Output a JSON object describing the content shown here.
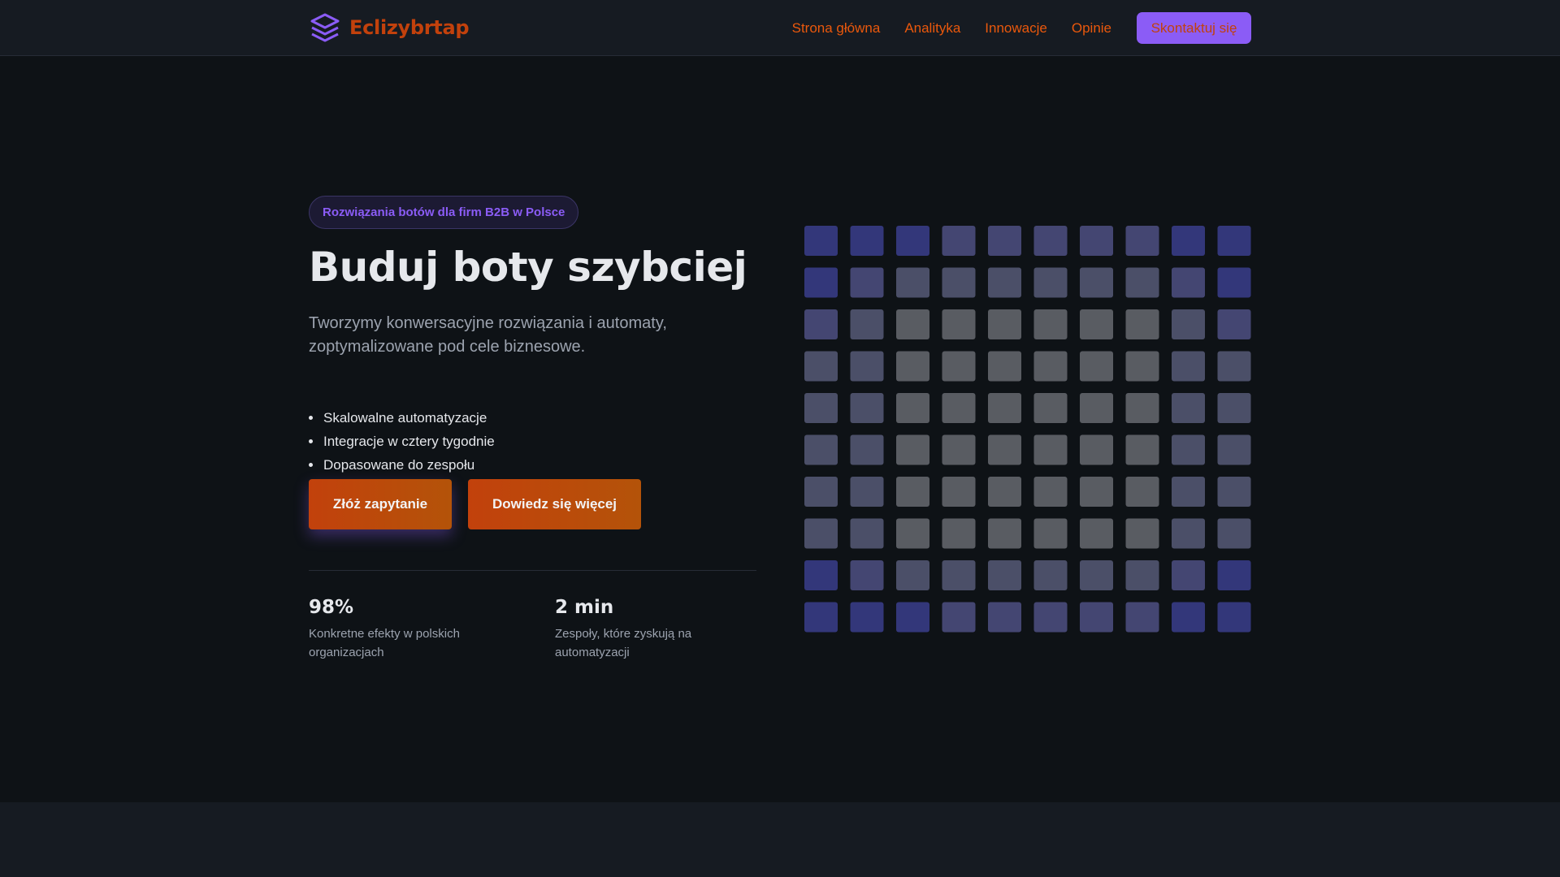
{
  "brand": {
    "name": "Eclizybrtap",
    "logo_icon": "layers-icon",
    "color": "#c2410c"
  },
  "nav": {
    "links": [
      "Strona główna",
      "Analityka",
      "Innowacje",
      "Opinie"
    ],
    "cta": "Skontaktuj się",
    "link_color": "#ea580c",
    "cta_bg": "#8b5cf6"
  },
  "hero": {
    "badge": "Rozwiązania botów dla firm B2B w Polsce",
    "title": "Buduj boty szybciej",
    "subtitle": "Tworzymy konwersacyjne rozwiązania i automaty, zoptymalizowane pod cele biznesowe.",
    "features": [
      "Skalowalne automatyzacje",
      "Integracje w cztery tygodnie",
      "Dopasowane do zespołu"
    ],
    "primary_button": "Złóż zapytanie",
    "secondary_button": "Dowiedz się więcej"
  },
  "stats": [
    {
      "value": "98%",
      "label": "Konkretne efekty w polskich organizacjach"
    },
    {
      "value": "2 min",
      "label": "Zespoły, które zyskują na automatyzacji"
    }
  ],
  "pattern": {
    "rows": 10,
    "cols": 10,
    "colors": {
      "blue": "#33377a",
      "purple": "#444672",
      "slate": "#4b4f68",
      "gray": "#595c62"
    },
    "cells": [
      "BBBPPPPPBB",
      "BPSSSSSSPB",
      "PSGGGGGGSP",
      "SSGGGGGGSS",
      "SSGGGGGGSS",
      "SSGGGGGGSS",
      "SSGGGGGGSS",
      "SSGGGGGGSS",
      "BPSSSSSSPB",
      "BBBPPPPPBB"
    ]
  }
}
